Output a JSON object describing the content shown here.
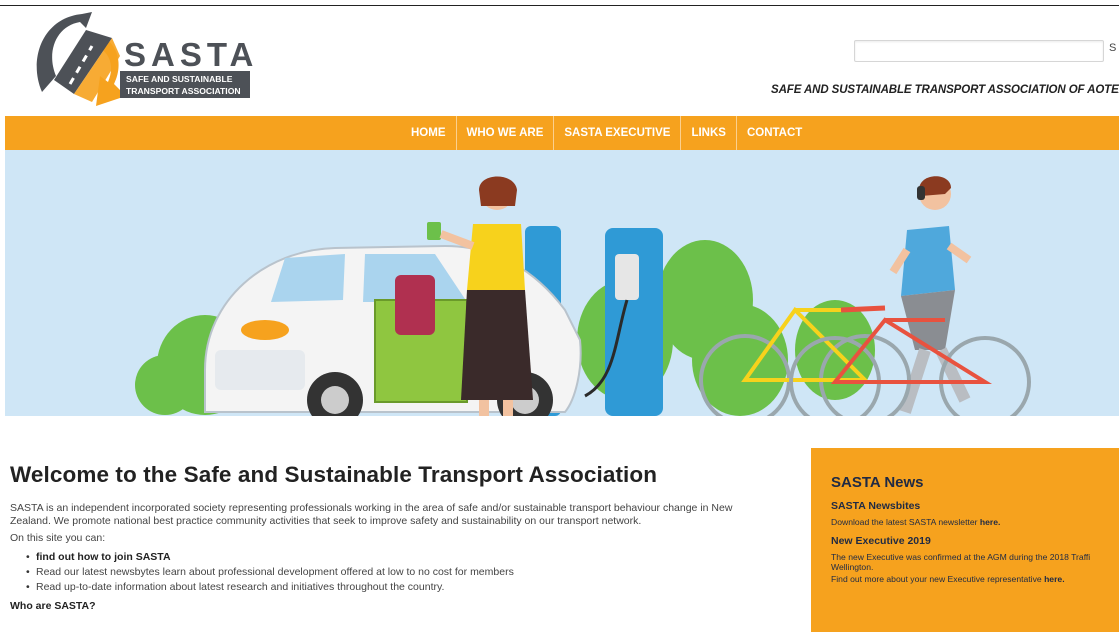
{
  "header": {
    "logo_word": "SASTA",
    "logo_line1": "SAFE AND SUSTAINABLE",
    "logo_line2": "TRANSPORT ASSOCIATION",
    "search_placeholder": "",
    "search_button": "S",
    "tagline": "SAFE AND SUSTAINABLE TRANSPORT ASSOCIATION OF AOTEAROA/NEW"
  },
  "nav": {
    "items": [
      {
        "label": "HOME"
      },
      {
        "label": "WHO WE ARE"
      },
      {
        "label": "SASTA EXECUTIVE"
      },
      {
        "label": "LINKS"
      },
      {
        "label": "CONTACT"
      }
    ]
  },
  "main": {
    "title": "Welcome to the Safe and Sustainable Transport Association",
    "intro": "SASTA is an independent incorporated society representing professionals working in the area of safe and/or sustainable transport behaviour change in New Zealand. We promote national best practice community activities that seek to improve safety and sustainability on our transport network.",
    "on_site": "On this site you can:",
    "bullets": [
      {
        "text": "find out how to join SASTA"
      },
      {
        "text": "Read our latest newsbytes learn about professional development offered at low to no cost for members"
      },
      {
        "text": "Read up-to-date information about latest research and initiatives throughout the country."
      }
    ],
    "who": "Who are SASTA?"
  },
  "sidebar": {
    "title": "SASTA News",
    "section1_title": "SASTA Newsbites",
    "section1_text": "Download the latest SASTA newsletter ",
    "section1_link": "here.",
    "section2_title": "New Executive 2019",
    "section2_line1": "The new Executive was confirmed at the AGM during the 2018 Traffi",
    "section2_line2": "Wellington.",
    "section2_line3": "Find out more about your new Executive representative ",
    "section2_link": "here."
  },
  "colors": {
    "brand_orange": "#f6a21e",
    "logo_gray": "#4d5157",
    "text_dark": "#222222",
    "sidebar_text": "#1f2a44"
  }
}
